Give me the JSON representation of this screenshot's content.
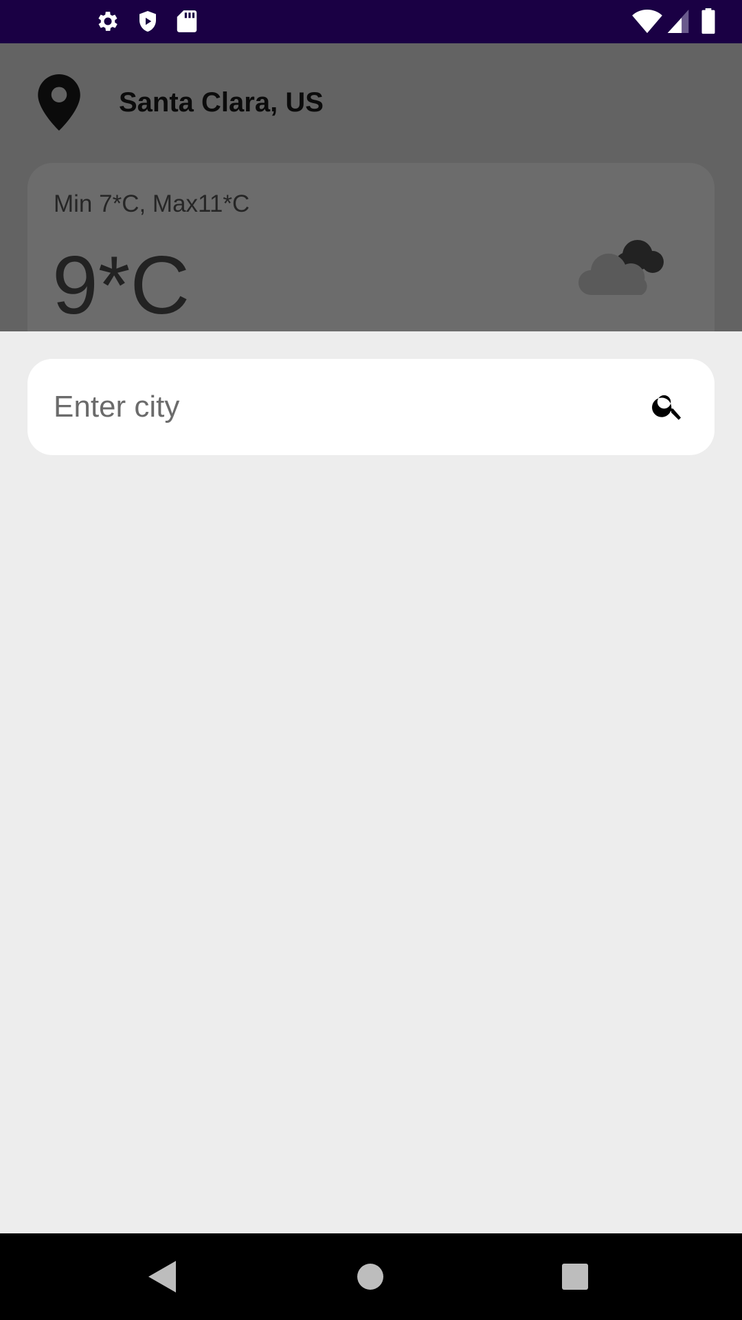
{
  "status_bar": {
    "left_icons": [
      "settings-icon",
      "play-protect-icon",
      "sd-card-icon"
    ],
    "right_icons": [
      "wifi-icon",
      "cell-signal-icon",
      "battery-icon"
    ]
  },
  "header": {
    "location_icon": "location-pin-icon",
    "city": "Santa Clara, US"
  },
  "weather_card": {
    "minmax": "Min 7*C, Max11*C",
    "temperature": "9*C",
    "condition_icon": "cloud-night-icon"
  },
  "search": {
    "placeholder": "Enter city",
    "value": "",
    "button_icon": "search-icon"
  },
  "nav_bar": {
    "buttons": [
      "back-icon",
      "home-icon",
      "recents-icon"
    ]
  },
  "colors": {
    "status_bar": "#1a0044",
    "scrim": "#636363",
    "sheet": "#ededed",
    "nav_bar": "#000000"
  }
}
